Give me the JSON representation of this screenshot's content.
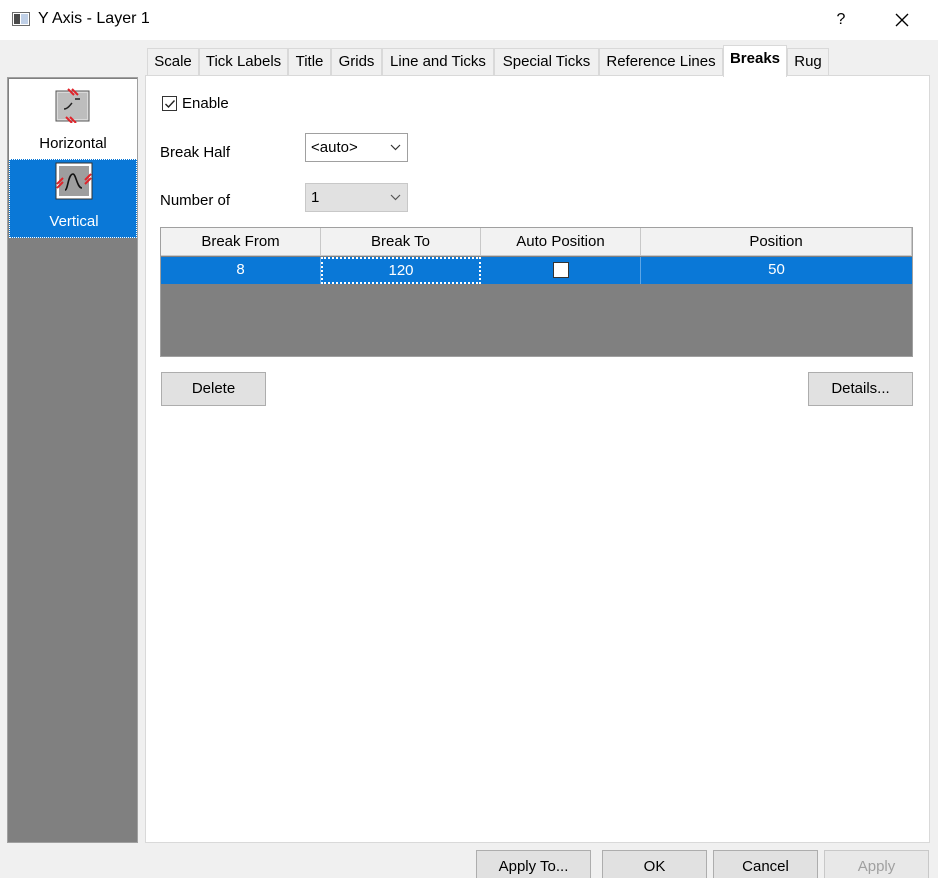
{
  "window": {
    "title": "Y Axis - Layer 1",
    "help": "?"
  },
  "left_panel": {
    "items": [
      {
        "label": "Horizontal",
        "icon": "axis-break-horizontal-icon",
        "selected": false
      },
      {
        "label": "Vertical",
        "icon": "axis-break-vertical-icon",
        "selected": true
      }
    ]
  },
  "tabs": [
    {
      "label": "Scale"
    },
    {
      "label": "Tick Labels"
    },
    {
      "label": "Title"
    },
    {
      "label": "Grids"
    },
    {
      "label": "Line and Ticks"
    },
    {
      "label": "Special Ticks"
    },
    {
      "label": "Reference Lines"
    },
    {
      "label": "Breaks",
      "active": true
    },
    {
      "label": "Rug"
    }
  ],
  "breaks": {
    "enable_label": "Enable",
    "enable_checked": true,
    "break_half_label": "Break Half",
    "break_half_value": "<auto>",
    "number_of_label": "Number of",
    "number_of_value": "1",
    "table": {
      "columns": [
        "Break From",
        "Break To",
        "Auto Position",
        "Position"
      ],
      "rows": [
        {
          "break_from": "8",
          "break_to": "120",
          "auto_position": false,
          "position": "50"
        }
      ]
    },
    "delete_label": "Delete",
    "details_label": "Details..."
  },
  "footer": {
    "apply_to_label": "Apply To...",
    "ok_label": "OK",
    "cancel_label": "Cancel",
    "apply_label": "Apply"
  },
  "colors": {
    "selection": "#0a78d7",
    "accent_red": "#e0242b"
  }
}
